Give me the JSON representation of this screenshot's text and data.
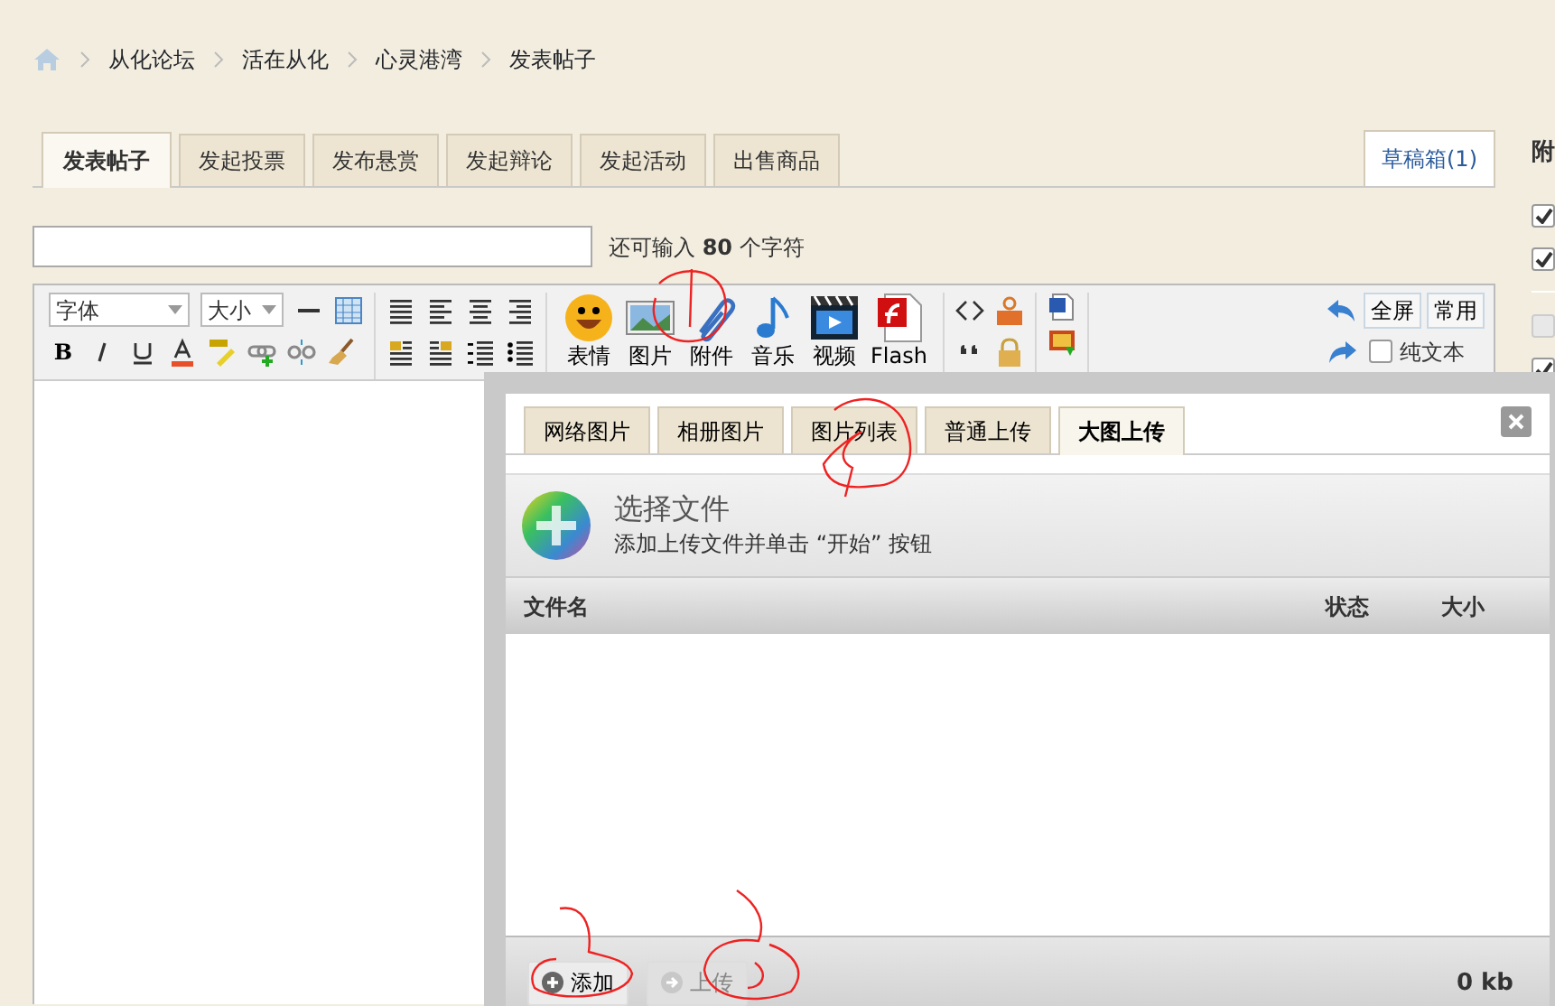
{
  "breadcrumb": [
    "从化论坛",
    "活在从化",
    "心灵港湾",
    "发表帖子"
  ],
  "post_tabs": [
    {
      "label": "发表帖子",
      "selected": true
    },
    {
      "label": "发起投票",
      "selected": false
    },
    {
      "label": "发布悬赏",
      "selected": false
    },
    {
      "label": "发起辩论",
      "selected": false
    },
    {
      "label": "发起活动",
      "selected": false
    },
    {
      "label": "出售商品",
      "selected": false
    }
  ],
  "drafts_button": "草稿箱(1)",
  "char_counter": "还可输入 **80** 个字符",
  "toolbar": {
    "font_select": "字体",
    "size_select": "大小",
    "bold_button": "B",
    "big_buttons": [
      {
        "label": "表情",
        "kind": "smiley"
      },
      {
        "label": "图片",
        "kind": "image"
      },
      {
        "label": "附件",
        "kind": "clip"
      },
      {
        "label": "音乐",
        "kind": "note"
      },
      {
        "label": "视频",
        "kind": "film"
      },
      {
        "label": "Flash",
        "kind": "flash"
      }
    ],
    "fullscreen_button": "全屏",
    "common_button": "常用",
    "plain_text": {
      "label": "纯文本",
      "checked": false
    }
  },
  "dialog": {
    "tabs": [
      {
        "label": "网络图片",
        "selected": false
      },
      {
        "label": "相册图片",
        "selected": false
      },
      {
        "label": "图片列表",
        "selected": false
      },
      {
        "label": "普通上传",
        "selected": false
      },
      {
        "label": "大图上传",
        "selected": true
      }
    ],
    "select_title": "选择文件",
    "select_hint": "添加上传文件并单击 “开始” 按钮",
    "columns": [
      "文件名",
      "状态",
      "大小"
    ],
    "buttons": [
      {
        "label": "添加",
        "disabled": false
      },
      {
        "label": "上传",
        "disabled": true
      }
    ],
    "total": "0 kb"
  },
  "sidebar": {
    "heading": "附",
    "checkboxes": [
      {
        "checked": true,
        "disabled": false
      },
      {
        "checked": true,
        "disabled": false
      },
      {
        "checked": false,
        "disabled": true
      },
      {
        "checked": true,
        "disabled": false
      }
    ]
  }
}
